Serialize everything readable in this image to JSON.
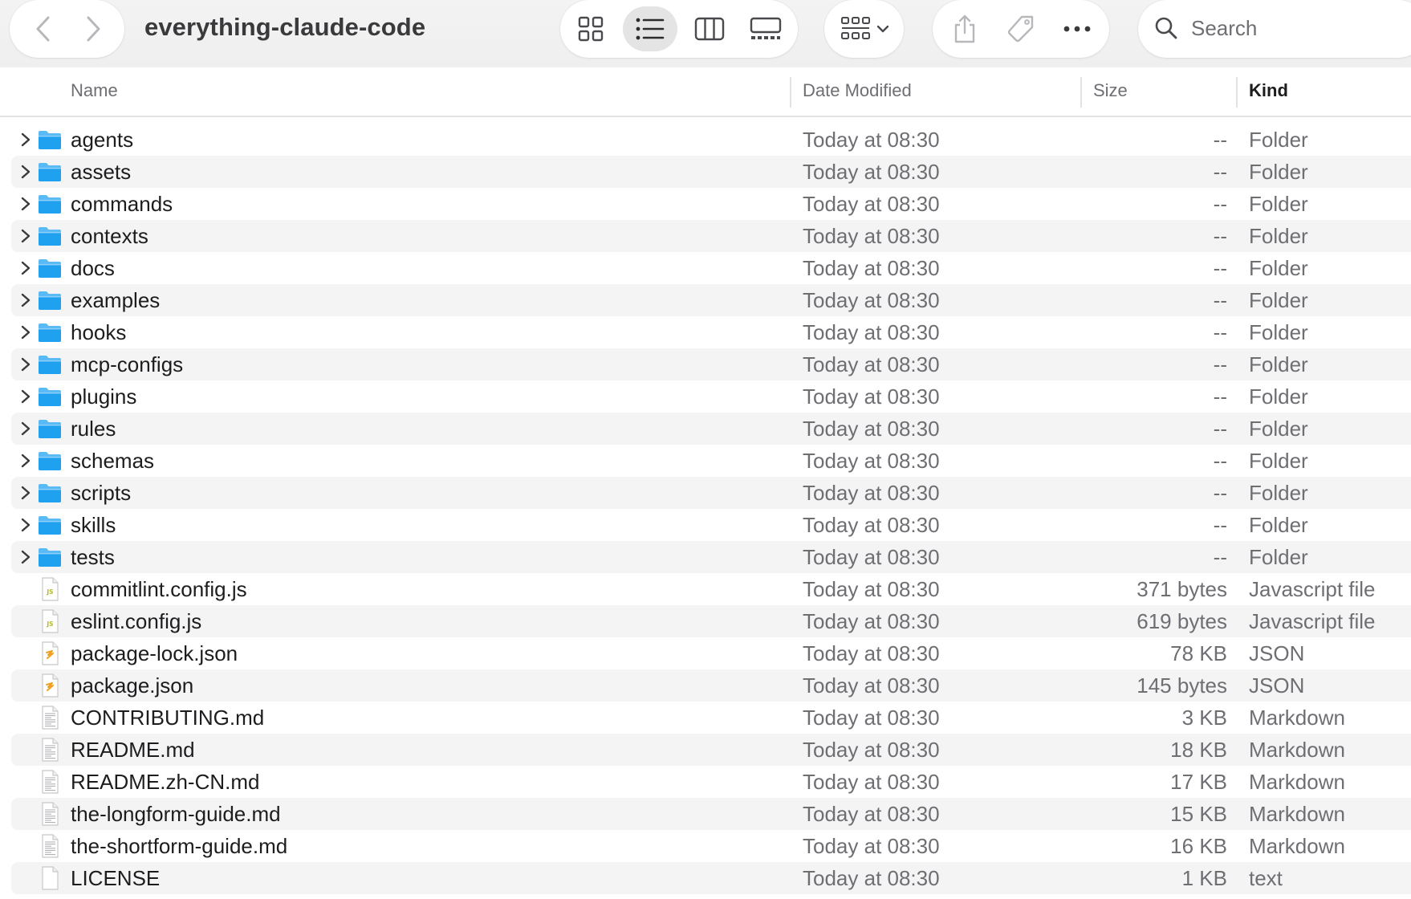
{
  "toolbar": {
    "window_title": "everything-claude-code",
    "search_placeholder": "Search",
    "icons": {
      "back": "chevron-left-icon",
      "forward": "chevron-right-icon",
      "icon_view": "grid-view-icon",
      "list_view": "list-view-icon",
      "column_view": "column-view-icon",
      "gallery_view": "gallery-view-icon",
      "group": "group-grid-icon",
      "share": "share-icon",
      "tag": "tag-icon",
      "more": "more-ellipsis-icon",
      "search": "search-icon"
    },
    "active_view": "list"
  },
  "columns": {
    "name": "Name",
    "date_modified": "Date Modified",
    "size": "Size",
    "kind": "Kind",
    "sorted_by": "kind"
  },
  "colors": {
    "folder_blue": "#1fa1f0",
    "js_badge": "#b5b82a",
    "json_badge": "#f0a020",
    "row_alt": "#f4f4f5"
  },
  "files": [
    {
      "name": "agents",
      "date": "Today at 08:30",
      "size": "--",
      "kind": "Folder",
      "icon": "folder"
    },
    {
      "name": "assets",
      "date": "Today at 08:30",
      "size": "--",
      "kind": "Folder",
      "icon": "folder"
    },
    {
      "name": "commands",
      "date": "Today at 08:30",
      "size": "--",
      "kind": "Folder",
      "icon": "folder"
    },
    {
      "name": "contexts",
      "date": "Today at 08:30",
      "size": "--",
      "kind": "Folder",
      "icon": "folder"
    },
    {
      "name": "docs",
      "date": "Today at 08:30",
      "size": "--",
      "kind": "Folder",
      "icon": "folder"
    },
    {
      "name": "examples",
      "date": "Today at 08:30",
      "size": "--",
      "kind": "Folder",
      "icon": "folder"
    },
    {
      "name": "hooks",
      "date": "Today at 08:30",
      "size": "--",
      "kind": "Folder",
      "icon": "folder"
    },
    {
      "name": "mcp-configs",
      "date": "Today at 08:30",
      "size": "--",
      "kind": "Folder",
      "icon": "folder"
    },
    {
      "name": "plugins",
      "date": "Today at 08:30",
      "size": "--",
      "kind": "Folder",
      "icon": "folder"
    },
    {
      "name": "rules",
      "date": "Today at 08:30",
      "size": "--",
      "kind": "Folder",
      "icon": "folder"
    },
    {
      "name": "schemas",
      "date": "Today at 08:30",
      "size": "--",
      "kind": "Folder",
      "icon": "folder"
    },
    {
      "name": "scripts",
      "date": "Today at 08:30",
      "size": "--",
      "kind": "Folder",
      "icon": "folder"
    },
    {
      "name": "skills",
      "date": "Today at 08:30",
      "size": "--",
      "kind": "Folder",
      "icon": "folder"
    },
    {
      "name": "tests",
      "date": "Today at 08:30",
      "size": "--",
      "kind": "Folder",
      "icon": "folder"
    },
    {
      "name": "commitlint.config.js",
      "date": "Today at 08:30",
      "size": "371 bytes",
      "kind": "Javascript file",
      "icon": "js"
    },
    {
      "name": "eslint.config.js",
      "date": "Today at 08:30",
      "size": "619 bytes",
      "kind": "Javascript file",
      "icon": "js"
    },
    {
      "name": "package-lock.json",
      "date": "Today at 08:30",
      "size": "78 KB",
      "kind": "JSON",
      "icon": "json"
    },
    {
      "name": "package.json",
      "date": "Today at 08:30",
      "size": "145 bytes",
      "kind": "JSON",
      "icon": "json"
    },
    {
      "name": "CONTRIBUTING.md",
      "date": "Today at 08:30",
      "size": "3 KB",
      "kind": "Markdown",
      "icon": "markdown"
    },
    {
      "name": "README.md",
      "date": "Today at 08:30",
      "size": "18 KB",
      "kind": "Markdown",
      "icon": "markdown"
    },
    {
      "name": "README.zh-CN.md",
      "date": "Today at 08:30",
      "size": "17 KB",
      "kind": "Markdown",
      "icon": "markdown"
    },
    {
      "name": "the-longform-guide.md",
      "date": "Today at 08:30",
      "size": "15 KB",
      "kind": "Markdown",
      "icon": "markdown"
    },
    {
      "name": "the-shortform-guide.md",
      "date": "Today at 08:30",
      "size": "16 KB",
      "kind": "Markdown",
      "icon": "markdown"
    },
    {
      "name": "LICENSE",
      "date": "Today at 08:30",
      "size": "1 KB",
      "kind": "text",
      "icon": "text"
    }
  ]
}
